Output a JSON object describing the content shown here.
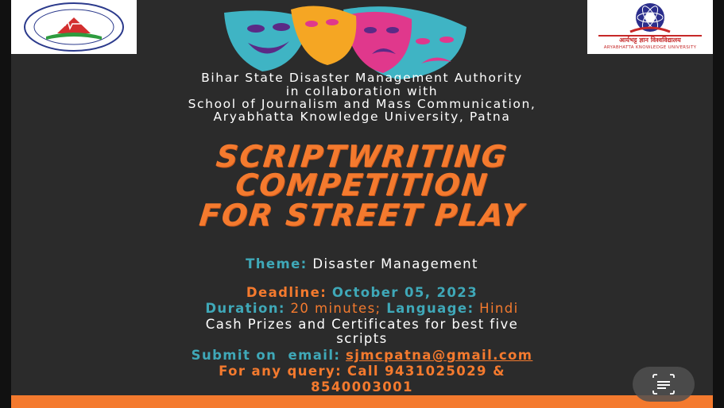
{
  "org_lines": [
    "Bihar State Disaster Management Authority",
    "in collaboration with",
    "School of Journalism and Mass Communication,",
    "Aryabhatta Knowledge University, Patna"
  ],
  "headline": [
    "SCRIPTWRITING",
    "COMPETITION",
    "FOR STREET PLAY"
  ],
  "theme": {
    "label": "Theme:",
    "value": "Disaster Management"
  },
  "deadline": {
    "label": "Deadline:",
    "value": "October 05, 2023"
  },
  "duration": {
    "label": "Duration:",
    "value": "20 minutes;",
    "lang_label": "Language:",
    "lang_value": "Hindi"
  },
  "prizes": [
    "Cash Prizes and Certificates for best five",
    "scripts"
  ],
  "submit": {
    "label": "Submit on  email:",
    "email": "sjmcpatna@gmail.com"
  },
  "query": {
    "label": "For any query:",
    "value_line1": "Call 9431025029 &",
    "value_line2": "8540003001"
  },
  "logos": {
    "left_icon": "bsdma-logo",
    "right_icon": "aku-logo",
    "right_caption_hi": "आर्यभट्ट ज्ञान विश्वविद्यालय",
    "right_caption_en": "ARYABHATTA KNOWLEDGE UNIVERSITY"
  },
  "decor": {
    "masks_icon": "theatre-masks-icon",
    "scan_icon": "text-scan-icon"
  },
  "colors": {
    "background": "#2b2b2b",
    "accent_orange": "#f47a2e",
    "accent_teal": "#3fa8b8"
  }
}
